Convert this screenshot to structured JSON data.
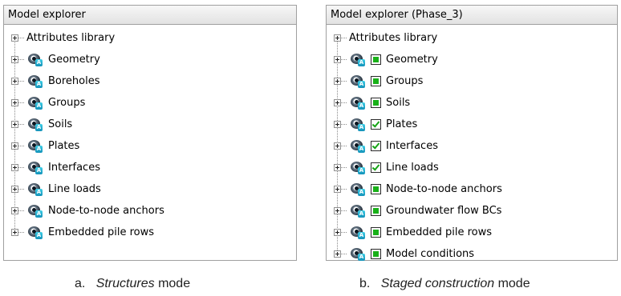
{
  "panels": [
    {
      "title": "Model explorer",
      "items": [
        {
          "label": "Attributes library",
          "eye": false,
          "check": "none"
        },
        {
          "label": "Geometry",
          "eye": true,
          "check": "none"
        },
        {
          "label": "Boreholes",
          "eye": true,
          "check": "none"
        },
        {
          "label": "Groups",
          "eye": true,
          "check": "none"
        },
        {
          "label": "Soils",
          "eye": true,
          "check": "none"
        },
        {
          "label": "Plates",
          "eye": true,
          "check": "none"
        },
        {
          "label": "Interfaces",
          "eye": true,
          "check": "none"
        },
        {
          "label": "Line loads",
          "eye": true,
          "check": "none"
        },
        {
          "label": "Node-to-node anchors",
          "eye": true,
          "check": "none"
        },
        {
          "label": "Embedded pile rows",
          "eye": true,
          "check": "none"
        }
      ]
    },
    {
      "title": "Model explorer (Phase_3)",
      "items": [
        {
          "label": "Attributes library",
          "eye": false,
          "check": "none"
        },
        {
          "label": "Geometry",
          "eye": true,
          "check": "filled"
        },
        {
          "label": "Groups",
          "eye": true,
          "check": "filled"
        },
        {
          "label": "Soils",
          "eye": true,
          "check": "filled"
        },
        {
          "label": "Plates",
          "eye": true,
          "check": "ticked"
        },
        {
          "label": "Interfaces",
          "eye": true,
          "check": "ticked"
        },
        {
          "label": "Line loads",
          "eye": true,
          "check": "ticked"
        },
        {
          "label": "Node-to-node anchors",
          "eye": true,
          "check": "filled"
        },
        {
          "label": "Groundwater flow BCs",
          "eye": true,
          "check": "filled"
        },
        {
          "label": "Embedded pile rows",
          "eye": true,
          "check": "filled"
        },
        {
          "label": "Model conditions",
          "eye": true,
          "check": "filled"
        }
      ]
    }
  ],
  "captions": {
    "a": {
      "prefix": "a.",
      "italic": "Structures",
      "suffix": "mode"
    },
    "b": {
      "prefix": "b.",
      "italic": "Staged construction",
      "suffix": "mode"
    }
  },
  "colors": {
    "check_fill": "#19b119",
    "eye_tag": "#1fa9cf",
    "panel_border": "#a0a0a0"
  },
  "icons": {
    "expander": "plus-expander-icon",
    "visibility": "eye-visibility-icon",
    "check": "checkbox-icon"
  }
}
